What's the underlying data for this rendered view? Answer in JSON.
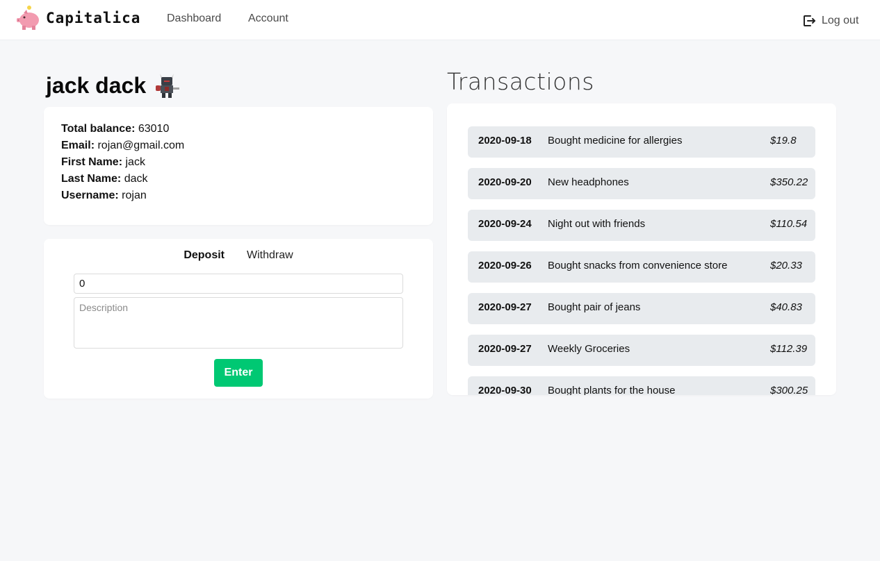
{
  "nav": {
    "brand": "Capitalica",
    "links": [
      "Dashboard",
      "Account"
    ],
    "logout": "Log out",
    "logout_icon": "logout-icon"
  },
  "user": {
    "display_name": "jack dack",
    "avatar_icon": "knight-avatar-icon",
    "fields": [
      {
        "label": "Total balance:",
        "value": "63010"
      },
      {
        "label": "Email:",
        "value": "rojan@gmail.com"
      },
      {
        "label": "First Name:",
        "value": "jack"
      },
      {
        "label": "Last Name:",
        "value": "dack"
      },
      {
        "label": "Username:",
        "value": "rojan"
      }
    ]
  },
  "form": {
    "tabs": [
      "Deposit",
      "Withdraw"
    ],
    "active_tab": "Deposit",
    "amount_value": "0",
    "description_placeholder": "Description",
    "submit_label": "Enter",
    "submit_color": "#00c873"
  },
  "transactions": {
    "title": "Transactions",
    "items": [
      {
        "date": "2020-09-18",
        "description": "Bought medicine for allergies",
        "amount": "$19.8"
      },
      {
        "date": "2020-09-20",
        "description": "New headphones",
        "amount": "$350.22"
      },
      {
        "date": "2020-09-24",
        "description": "Night out with friends",
        "amount": "$110.54"
      },
      {
        "date": "2020-09-26",
        "description": "Bought snacks from convenience store",
        "amount": "$20.33"
      },
      {
        "date": "2020-09-27",
        "description": "Bought pair of jeans",
        "amount": "$40.83"
      },
      {
        "date": "2020-09-27",
        "description": "Weekly Groceries",
        "amount": "$112.39"
      },
      {
        "date": "2020-09-30",
        "description": "Bought plants for the house",
        "amount": "$300.25"
      }
    ]
  }
}
